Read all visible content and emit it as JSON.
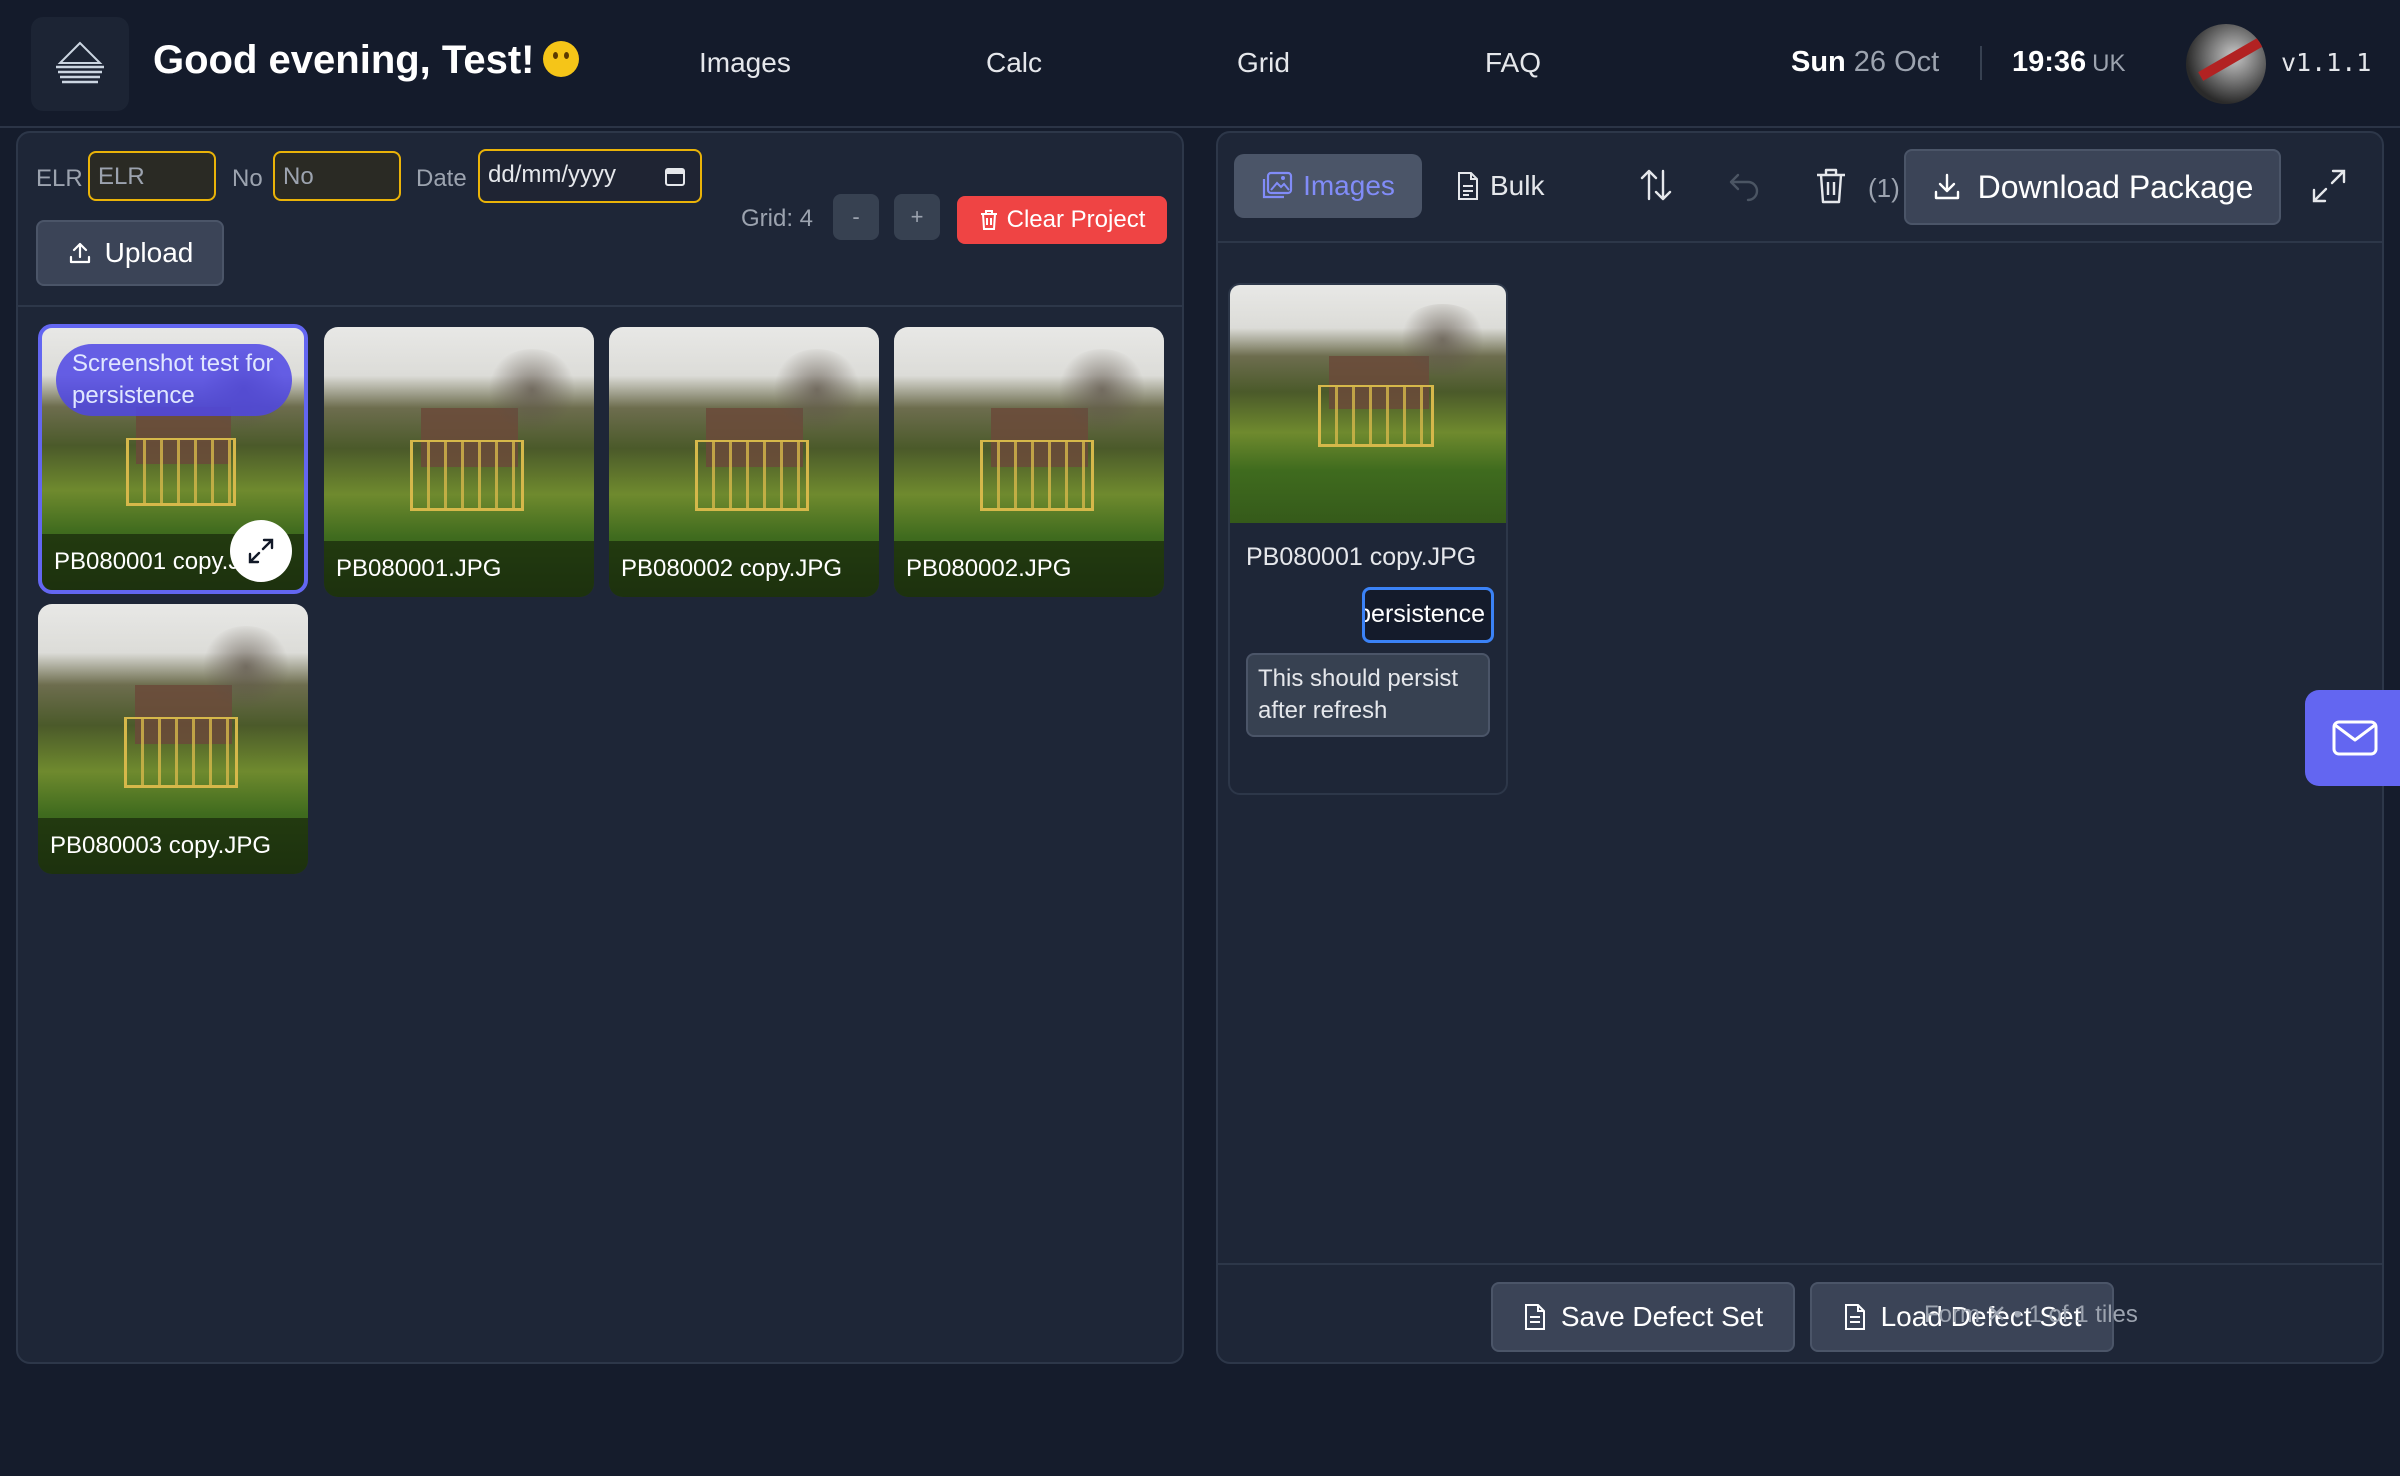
{
  "header": {
    "greeting": "Good evening, Test!",
    "nav": [
      "Images",
      "Calc",
      "Grid",
      "FAQ"
    ],
    "day": "Sun",
    "date": "26 Oct",
    "time": "19:36",
    "timezone": "UK",
    "version": "v1.1.1"
  },
  "left": {
    "elr_label": "ELR",
    "elr_placeholder": "ELR",
    "no_label": "No",
    "no_placeholder": "No",
    "date_label": "Date",
    "date_placeholder": "dd/mm/yyyy",
    "upload_label": "Upload",
    "grid_label": "Grid: 4",
    "minus_label": "-",
    "plus_label": "+",
    "clear_label": "Clear Project",
    "thumbnails": [
      {
        "caption": "PB080001 copy.JPG",
        "selected": true,
        "note": "Screenshot test for persistence"
      },
      {
        "caption": "PB080001.JPG"
      },
      {
        "caption": "PB080002 copy.JPG"
      },
      {
        "caption": "PB080002.JPG"
      },
      {
        "caption": "PB080003 copy.JPG"
      }
    ]
  },
  "right": {
    "tab_images": "Images",
    "tab_bulk": "Bulk",
    "trash_count": "(1)",
    "download_label": "Download Package",
    "tile": {
      "name": "PB080001 copy.JPG",
      "input_value": "Screenshot test for persistence",
      "description": "This should persist after refresh"
    },
    "save_label": "Save Defect Set",
    "load_label": "Load Defect Set",
    "status": "Form ✕ • 1 of 1 tiles"
  },
  "colors": {
    "accent": "#6366f1",
    "danger": "#ef4444",
    "field_border": "#eab308"
  }
}
